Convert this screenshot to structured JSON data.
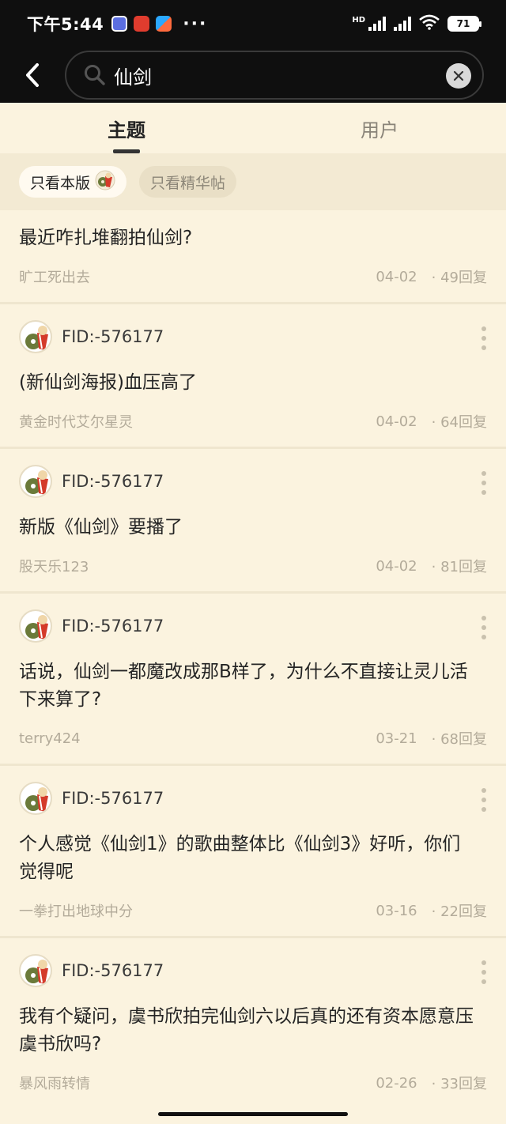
{
  "status_bar": {
    "time": "下午5:44",
    "more": "···",
    "network": "HD",
    "battery": "71"
  },
  "search": {
    "query": "仙剑"
  },
  "tabs": [
    {
      "label": "主题",
      "active": true
    },
    {
      "label": "用户",
      "active": false
    }
  ],
  "filters": {
    "only_this_board": "只看本版",
    "only_featured": "只看精华帖"
  },
  "posts": [
    {
      "title": "最近咋扎堆翻拍仙剑?",
      "author": "旷工死出去",
      "date": "04-02",
      "replies": "· 49回复"
    },
    {
      "user": "FID:-576177",
      "title": "(新仙剑海报)血压高了",
      "author": "黄金时代艾尔星灵",
      "date": "04-02",
      "replies": "· 64回复"
    },
    {
      "user": "FID:-576177",
      "title": "新版《仙剑》要播了",
      "author": "股天乐123",
      "date": "04-02",
      "replies": "· 81回复"
    },
    {
      "user": "FID:-576177",
      "title": "话说，仙剑一都魔改成那B样了，为什么不直接让灵儿活下来算了?",
      "author": "terry424",
      "date": "03-21",
      "replies": "· 68回复"
    },
    {
      "user": "FID:-576177",
      "title": "个人感觉《仙剑1》的歌曲整体比《仙剑3》好听，你们觉得呢",
      "author": "一拳打出地球中分",
      "date": "03-16",
      "replies": "· 22回复"
    },
    {
      "user": "FID:-576177",
      "title": "我有个疑问，虞书欣拍完仙剑六以后真的还有资本愿意压虞书欣吗?",
      "author": "暴风雨转情",
      "date": "02-26",
      "replies": "· 33回复"
    }
  ]
}
